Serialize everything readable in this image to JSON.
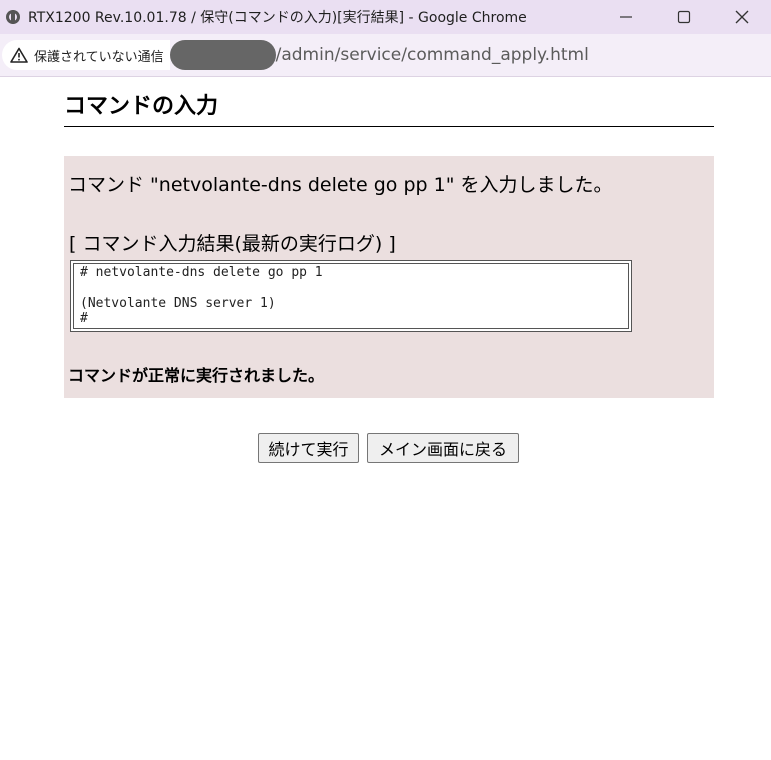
{
  "window": {
    "title": "RTX1200 Rev.10.01.78 / 保守(コマンドの入力)[実行結果] - Google Chrome"
  },
  "addressbar": {
    "security_label": "保護されていない通信",
    "url_path": "/admin/service/command_apply.html"
  },
  "page": {
    "heading": "コマンドの入力",
    "entered_message": "コマンド \"netvolante-dns delete go pp 1\" を入力しました。",
    "log_heading": "[ コマンド入力結果(最新の実行ログ) ]",
    "log_lines": {
      "line1": "# netvolante-dns delete go pp 1",
      "line2": "(Netvolante DNS server 1)",
      "line3": "#"
    },
    "success_message": "コマンドが正常に実行されました。"
  },
  "buttons": {
    "continue_label": "続けて実行",
    "back_to_main_label": "メイン画面に戻る"
  },
  "colors": {
    "titlebar_bg": "#eadff2",
    "addressbar_bg": "#f4eef8",
    "panel_bg": "#ebdfdf",
    "redaction": "#666666"
  },
  "icons": {
    "title": "globe-icon",
    "security": "warning-triangle-icon",
    "minimize": "minimize-icon",
    "maximize": "maximize-icon",
    "close": "close-icon"
  }
}
